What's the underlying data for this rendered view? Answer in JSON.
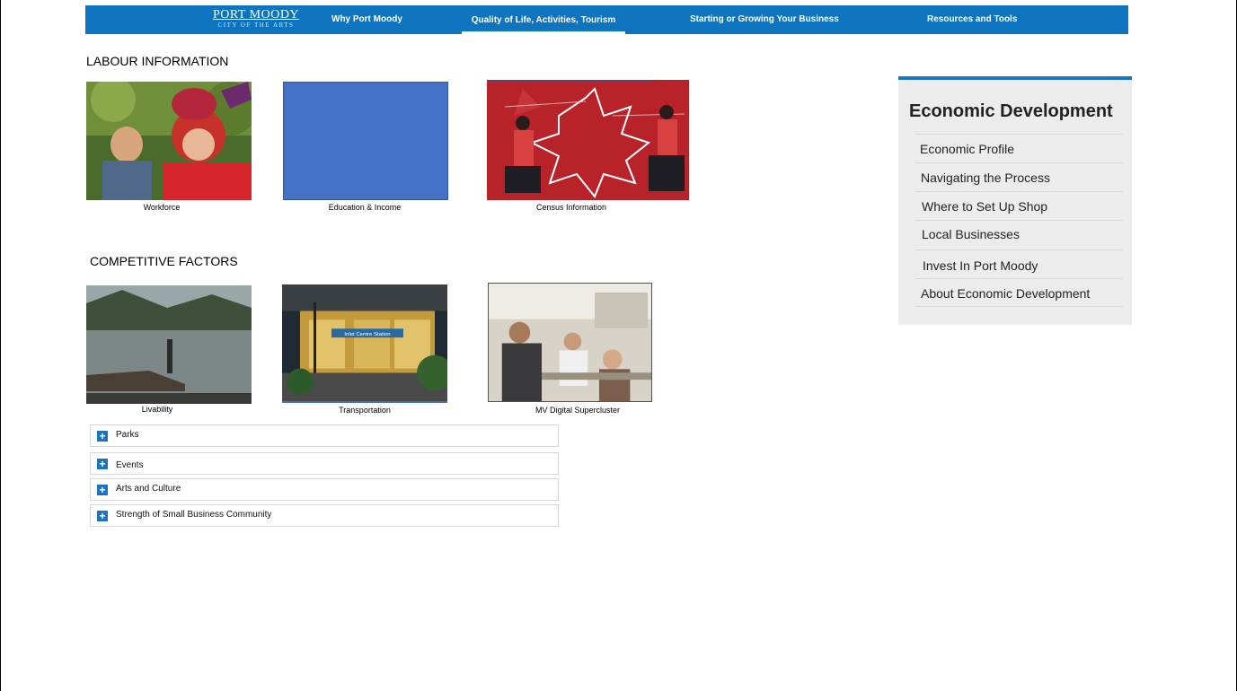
{
  "nav": {
    "logo_main": "PORT MOODY",
    "logo_sub": "CITY OF THE ARTS",
    "items": [
      {
        "label": "Why Port Moody"
      },
      {
        "label": "Quality of Life, Activities, Tourism"
      },
      {
        "label": "Starting or Growing Your Business"
      },
      {
        "label": "Resources and Tools"
      }
    ],
    "active_index": 1,
    "color": "#0f74c0"
  },
  "labour": {
    "title": "LABOUR INFORMATION",
    "tiles": [
      {
        "label": "Workforce",
        "image": "festival-performers-photo"
      },
      {
        "label": "Education & Income",
        "image": "blue-placeholder"
      },
      {
        "label": "Census Information",
        "image": "maple-leaf-illustration"
      }
    ]
  },
  "competitive": {
    "title": "COMPETITIVE FACTORS",
    "tiles": [
      {
        "label": "Livability",
        "image": "lake-pier-photo"
      },
      {
        "label": "Transportation",
        "image": "inlet-centre-station-photo"
      },
      {
        "label": "MV Digital Supercluster",
        "image": "office-workers-photo"
      }
    ]
  },
  "accordion": [
    {
      "label": "Parks"
    },
    {
      "label": "Events"
    },
    {
      "label": "Arts and Culture"
    },
    {
      "label": "Strength of Small Business Community"
    }
  ],
  "sidebar": {
    "title": "Economic Development",
    "items": [
      {
        "label": "Economic Profile"
      },
      {
        "label": "Navigating the Process"
      },
      {
        "label": "Where to Set Up Shop"
      },
      {
        "label": "Local Businesses"
      },
      {
        "label": "Invest In Port Moody"
      },
      {
        "label": "About Economic Development"
      }
    ],
    "accent": "#1a73c4"
  },
  "photo_text": {
    "station_sign": "Inlet Centre Station"
  }
}
